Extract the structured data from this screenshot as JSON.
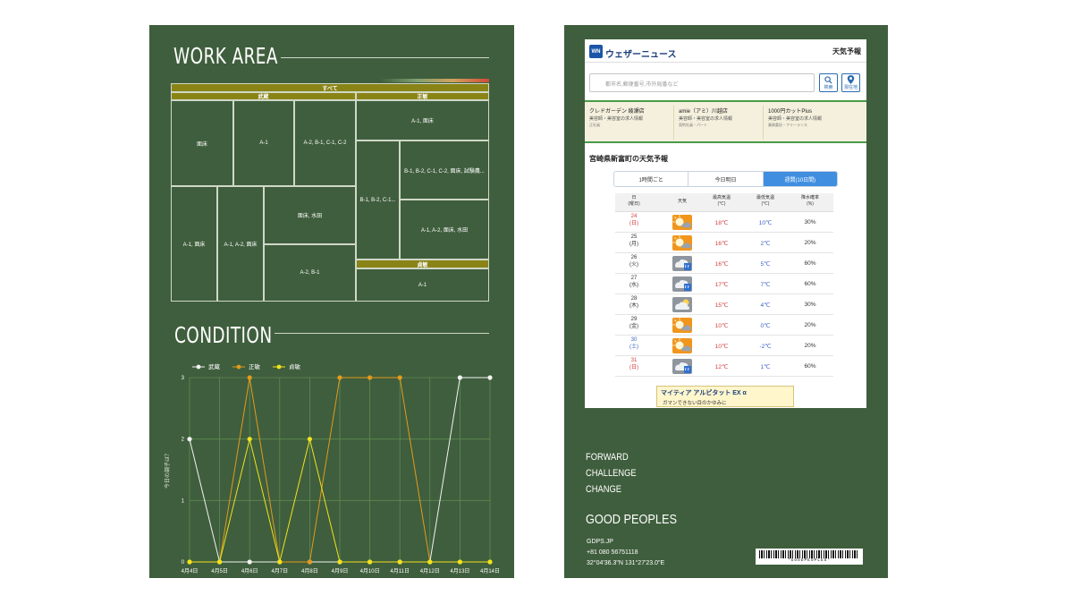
{
  "work_area": {
    "title": "WORK AREA",
    "all_label": "すべて",
    "section_a_label": "武蔵",
    "section_b_label": "正敏",
    "section_c_label": "貞敏",
    "cells": {
      "a1": "面床",
      "a2": "A-1",
      "a3": "A-2, B-1, C-1, C-2",
      "a4": "A-1, 面床",
      "a5": "A-1, A-2, 面床",
      "a6": "面床, 水田",
      "a7": "A-2, B-1",
      "b1": "A-1, 面床",
      "b2": "B-1, B-2, C-1, C-2, 面床, 試験農...",
      "b3": "B-1, B-2, C-1...",
      "b4": "A-1, A-2, 面床, 水田",
      "c1": "A-1"
    }
  },
  "condition": {
    "title": "CONDITION",
    "chart_data": {
      "type": "line",
      "title": "",
      "xlabel": "",
      "ylabel": "今日の調子は？",
      "ylim": [
        0,
        3
      ],
      "yticks": [
        "0",
        "1",
        "2",
        "3"
      ],
      "categories": [
        "4月4日",
        "4月5日",
        "4月6日",
        "4月7日",
        "4月8日",
        "4月9日",
        "4月10日",
        "4月11日",
        "4月12日",
        "4月13日",
        "4月14日"
      ],
      "series": [
        {
          "name": "武蔵",
          "color": "#f2f2f2",
          "values": [
            2,
            0,
            0,
            0,
            0,
            0,
            0,
            0,
            0,
            3,
            3
          ]
        },
        {
          "name": "正敏",
          "color": "#e39a1c",
          "values": [
            0,
            0,
            3,
            0,
            0,
            3,
            3,
            3,
            0,
            0,
            0
          ]
        },
        {
          "name": "貞敏",
          "color": "#f2e21c",
          "values": [
            0,
            0,
            2,
            0,
            2,
            0,
            0,
            0,
            0,
            0,
            0
          ]
        }
      ]
    }
  },
  "weather": {
    "app_name": "ウェザーニュース",
    "logo_text": "WN",
    "header_right": "天気予報",
    "search_placeholder": "都市名,郵便番号,市外局番など",
    "search_button": "検索",
    "location_button": "現在地",
    "ads": [
      {
        "title": "クレドガーデン 綾瀬店",
        "sub": "美容師・美容室の求人情報",
        "meta": "正社員"
      },
      {
        "title": "amie（アミ）川越店",
        "sub": "美容師・美容室の求人情報",
        "meta": "契約社員・パート"
      },
      {
        "title": "1000円カットPlus",
        "sub": "美容師・美容室の求人情報",
        "meta": "業務委託・フリーランス"
      }
    ],
    "location_title": "宮崎県新富町の天気予報",
    "tabs": [
      "1時間ごと",
      "今日明日",
      "週間(10日間)"
    ],
    "table_headers": {
      "date": "日\n(曜日)",
      "weather": "天気",
      "high": "最高気温\n(℃)",
      "low": "最低気温\n(℃)",
      "precip": "降水確率\n(%)"
    },
    "rows": [
      {
        "day": "24",
        "dow": "(日)",
        "day_color": "#d43b3b",
        "icon": "sun-cloud-icon",
        "high": "18℃",
        "low": "10℃",
        "precip": "30%"
      },
      {
        "day": "25",
        "dow": "(月)",
        "day_color": "#333333",
        "icon": "sun-cloud-icon",
        "high": "16℃",
        "low": "2℃",
        "precip": "20%"
      },
      {
        "day": "26",
        "dow": "(火)",
        "day_color": "#333333",
        "icon": "cloud-rain-icon",
        "high": "16℃",
        "low": "5℃",
        "precip": "60%"
      },
      {
        "day": "27",
        "dow": "(水)",
        "day_color": "#333333",
        "icon": "cloud-rain-icon",
        "high": "17℃",
        "low": "7℃",
        "precip": "60%"
      },
      {
        "day": "28",
        "dow": "(木)",
        "day_color": "#333333",
        "icon": "cloud-sun-icon",
        "high": "15℃",
        "low": "4℃",
        "precip": "30%"
      },
      {
        "day": "29",
        "dow": "(金)",
        "day_color": "#333333",
        "icon": "sun-cloud-icon",
        "high": "10℃",
        "low": "0℃",
        "precip": "20%"
      },
      {
        "day": "30",
        "dow": "(土)",
        "day_color": "#3b60c8",
        "icon": "sun-cloud-icon",
        "high": "10℃",
        "low": "-2℃",
        "precip": "20%"
      },
      {
        "day": "31",
        "dow": "(日)",
        "day_color": "#d43b3b",
        "icon": "cloud-rain-icon",
        "high": "12℃",
        "low": "1℃",
        "precip": "60%"
      }
    ],
    "bottom_ad_title": "マイティア アルピタット EX α",
    "bottom_ad_sub": "ガマンできない目のかゆみに",
    "close_label": "✕"
  },
  "brand": {
    "motto": [
      "FORWARD",
      "CHALLENGE",
      "CHANGE"
    ],
    "name": "GOOD PEOPLES",
    "site": "GDPS.JP",
    "phone": "+81 080 56751118",
    "coords": "32°04'36.3\"N 131°27'23.0\"E",
    "barcode_text": "*GOODPEOPLES*"
  },
  "colors": {
    "panel_bg": "#3f5e3d",
    "header_gold": "#8a8417",
    "accent_blue": "#3f8ee0"
  }
}
